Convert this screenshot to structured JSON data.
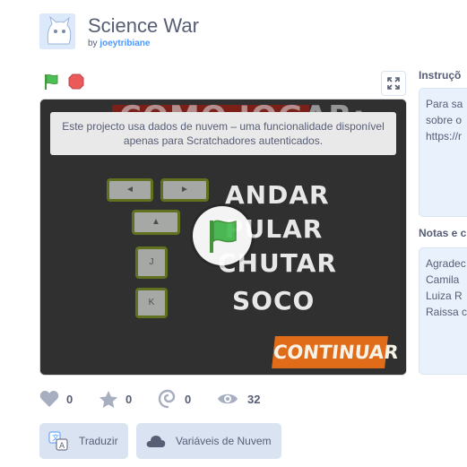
{
  "project": {
    "title": "Science War",
    "by_prefix": "by",
    "author": "joeytribiane"
  },
  "stage": {
    "notice": "Este projecto usa dados de nuvem – uma funcionalidade disponível apenas para Scratchadores autenticados.",
    "header_text": "COMO JOGAR:",
    "keys": [
      "◄",
      "►",
      "▲",
      "J",
      "K"
    ],
    "actions": [
      "ANDAR",
      "PULAR",
      "CHUTAR",
      "SOCO"
    ],
    "continue_label": "CONTINUAR"
  },
  "stats": {
    "loves": "0",
    "favorites": "0",
    "remixes": "0",
    "views": "32"
  },
  "buttons": {
    "translate": "Traduzir",
    "cloud_variables": "Variáveis de Nuvem"
  },
  "sidebar": {
    "instructions_label": "Instruçõ",
    "instructions_lines": [
      "Para sa",
      "sobre o",
      "https://r"
    ],
    "notes_label": "Notas e c",
    "notes_lines": [
      "Agradec",
      "Camila",
      "Luiza R",
      "Raissa c"
    ]
  },
  "colors": {
    "accent": "#4c97ff",
    "text": "#575e75",
    "flag_green": "#4cbf56",
    "stop_red": "#ec5959",
    "continue_orange": "#e06c1a"
  }
}
